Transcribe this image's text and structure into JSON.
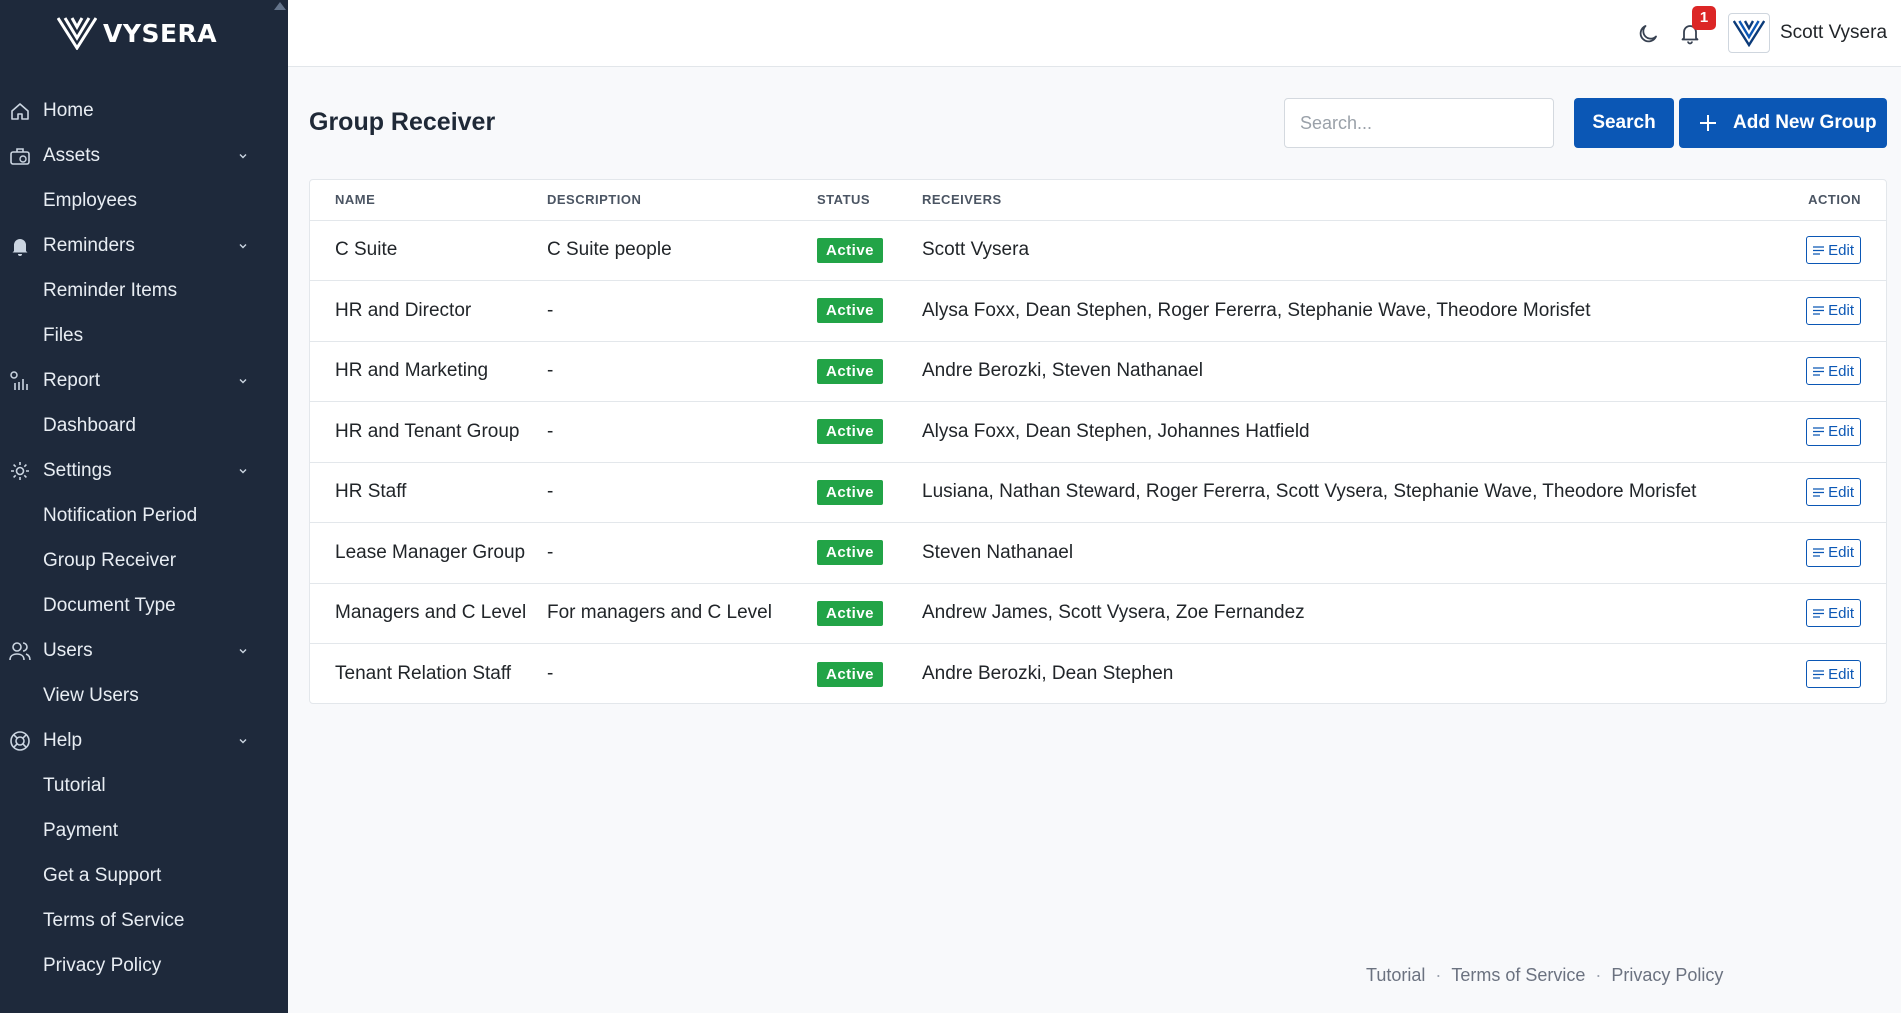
{
  "brand": {
    "name": "VYSERA"
  },
  "sidebar": {
    "items": [
      {
        "label": "Home",
        "icon": "home-icon",
        "expandable": false,
        "sub": false
      },
      {
        "label": "Assets",
        "icon": "assets-icon",
        "expandable": true,
        "sub": false
      },
      {
        "label": "Employees",
        "icon": "",
        "expandable": false,
        "sub": true
      },
      {
        "label": "Reminders",
        "icon": "bell-icon",
        "expandable": true,
        "sub": false
      },
      {
        "label": "Reminder Items",
        "icon": "",
        "expandable": false,
        "sub": true
      },
      {
        "label": "Files",
        "icon": "",
        "expandable": false,
        "sub": true
      },
      {
        "label": "Report",
        "icon": "report-icon",
        "expandable": true,
        "sub": false
      },
      {
        "label": "Dashboard",
        "icon": "",
        "expandable": false,
        "sub": true
      },
      {
        "label": "Settings",
        "icon": "gear-icon",
        "expandable": true,
        "sub": false
      },
      {
        "label": "Notification Period",
        "icon": "",
        "expandable": false,
        "sub": true
      },
      {
        "label": "Group Receiver",
        "icon": "",
        "expandable": false,
        "sub": true
      },
      {
        "label": "Document Type",
        "icon": "",
        "expandable": false,
        "sub": true
      },
      {
        "label": "Users",
        "icon": "users-icon",
        "expandable": true,
        "sub": false
      },
      {
        "label": "View Users",
        "icon": "",
        "expandable": false,
        "sub": true
      },
      {
        "label": "Help",
        "icon": "lifebuoy-icon",
        "expandable": true,
        "sub": false
      },
      {
        "label": "Tutorial",
        "icon": "",
        "expandable": false,
        "sub": true
      },
      {
        "label": "Payment",
        "icon": "",
        "expandable": false,
        "sub": true
      },
      {
        "label": "Get a Support",
        "icon": "",
        "expandable": false,
        "sub": true
      },
      {
        "label": "Terms of Service",
        "icon": "",
        "expandable": false,
        "sub": true
      },
      {
        "label": "Privacy Policy",
        "icon": "",
        "expandable": false,
        "sub": true
      }
    ]
  },
  "topbar": {
    "notification_count": "1",
    "user_name": "Scott Vysera"
  },
  "page": {
    "title": "Group Receiver",
    "search_placeholder": "Search...",
    "search_button": "Search",
    "add_button": "Add New Group"
  },
  "table": {
    "headers": {
      "name": "NAME",
      "description": "DESCRIPTION",
      "status": "STATUS",
      "receivers": "RECEIVERS",
      "action": "ACTION"
    },
    "edit_label": "Edit",
    "rows": [
      {
        "name": "C Suite",
        "description": "C Suite people",
        "status": "Active",
        "receivers": "Scott Vysera"
      },
      {
        "name": "HR and Director",
        "description": "-",
        "status": "Active",
        "receivers": "Alysa Foxx, Dean Stephen, Roger Fererra, Stephanie Wave, Theodore Morisfet"
      },
      {
        "name": "HR and Marketing",
        "description": "-",
        "status": "Active",
        "receivers": "Andre Berozki, Steven Nathanael"
      },
      {
        "name": "HR and Tenant Group",
        "description": "-",
        "status": "Active",
        "receivers": "Alysa Foxx, Dean Stephen, Johannes Hatfield"
      },
      {
        "name": "HR Staff",
        "description": "-",
        "status": "Active",
        "receivers": "Lusiana, Nathan Steward, Roger Fererra, Scott Vysera, Stephanie Wave, Theodore Morisfet"
      },
      {
        "name": "Lease Manager Group",
        "description": "-",
        "status": "Active",
        "receivers": "Steven Nathanael"
      },
      {
        "name": "Managers and C Level",
        "description": "For managers and C Level",
        "status": "Active",
        "receivers": "Andrew James, Scott Vysera, Zoe Fernandez"
      },
      {
        "name": "Tenant Relation Staff",
        "description": "-",
        "status": "Active",
        "receivers": "Andre Berozki, Dean Stephen"
      }
    ]
  },
  "footer": {
    "links": [
      "Tutorial",
      "Terms of Service",
      "Privacy Policy"
    ],
    "separator": "·"
  },
  "colors": {
    "sidebar_bg": "#1e293b",
    "primary": "#0b57b5",
    "active_badge": "#22a447",
    "notification_badge": "#dc2626"
  }
}
